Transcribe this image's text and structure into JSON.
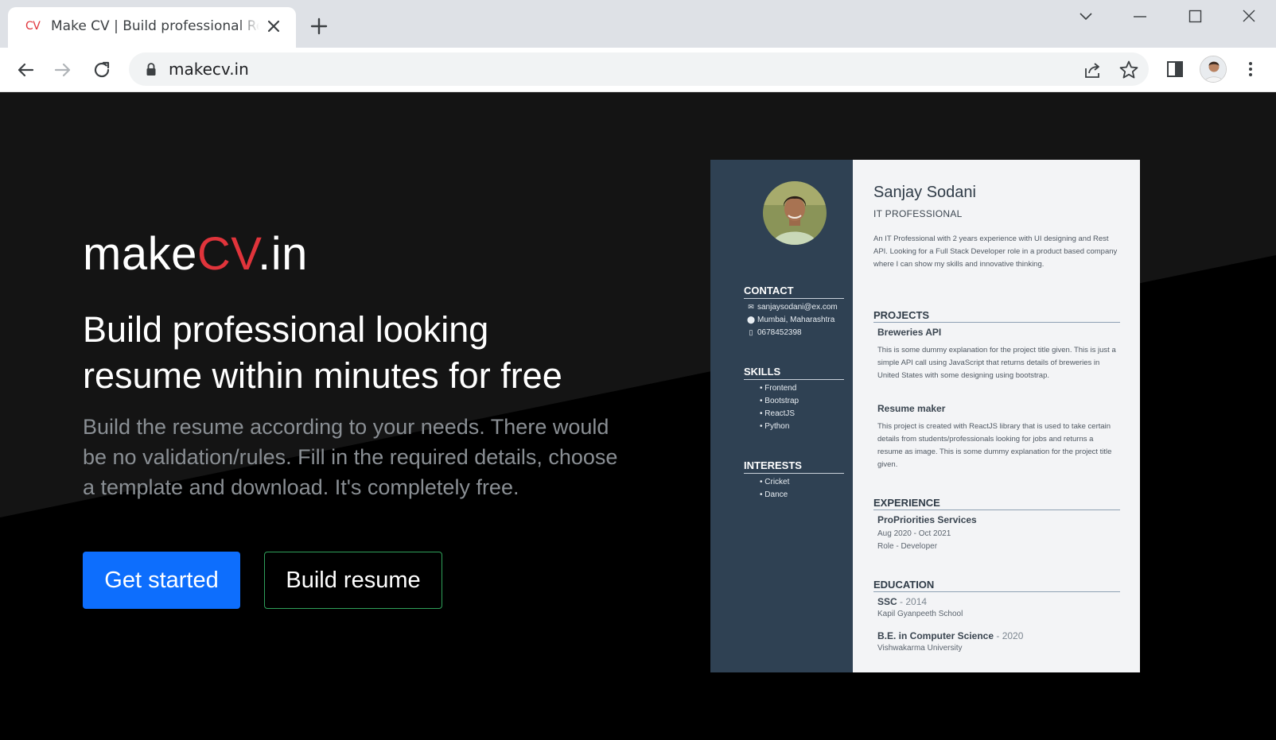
{
  "browser": {
    "tab_favicon": "CV",
    "tab_title": "Make CV | Build professional Resume",
    "url": "makecv.in"
  },
  "hero": {
    "brand_prefix": "make",
    "brand_accent": "CV",
    "brand_suffix": ".in",
    "headline_line1": "Build professional looking",
    "headline_line2": "resume within minutes for free",
    "lead": "Build the resume according to your needs. There would be no validation/rules. Fill in the required details, choose a template and download. It's completely free.",
    "primary_button": "Get started",
    "secondary_button": "Build resume"
  },
  "colors": {
    "accent": "#e0343b",
    "primary": "#0d6efd",
    "resume_sidebar": "#2f4153"
  },
  "resume": {
    "name": "Sanjay Sodani",
    "role": "IT PROFESSIONAL",
    "summary": "An IT Professional with 2 years experience with UI designing and Rest API. Looking for a Full Stack Developer role in a product based company where I can show my skills and innovative thinking.",
    "contact_title": "CONTACT",
    "contact": {
      "email": "sanjaysodani@ex.com",
      "location": "Mumbai, Maharashtra",
      "phone": "0678452398"
    },
    "skills_title": "SKILLS",
    "skills": [
      "• Frontend",
      "• Bootstrap",
      "• ReactJS",
      "• Python"
    ],
    "interests_title": "INTERESTS",
    "interests": [
      "• Cricket",
      "• Dance"
    ],
    "projects_title": "PROJECTS",
    "projects": [
      {
        "title": "Breweries API",
        "desc": "This is some dummy explanation for the project title given. This is just a simple API call using JavaScript that returns details of breweries in United States with some designing using bootstrap."
      },
      {
        "title": "Resume maker",
        "desc": "This project is created with ReactJS library that is used to take certain details from students/professionals looking for jobs and returns a resume as image. This is some dummy explanation for the project title given."
      }
    ],
    "experience_title": "EXPERIENCE",
    "experience": {
      "company": "ProPriorities Services",
      "dates": "Aug 2020 - Oct 2021",
      "role": "Role - Developer"
    },
    "education_title": "EDUCATION",
    "education": [
      {
        "degree": "SSC",
        "year": " - 2014",
        "school": "Kapil Gyanpeeth School"
      },
      {
        "degree": "B.E. in Computer Science",
        "year": " - 2020",
        "school": "Vishwakarma University"
      }
    ]
  }
}
